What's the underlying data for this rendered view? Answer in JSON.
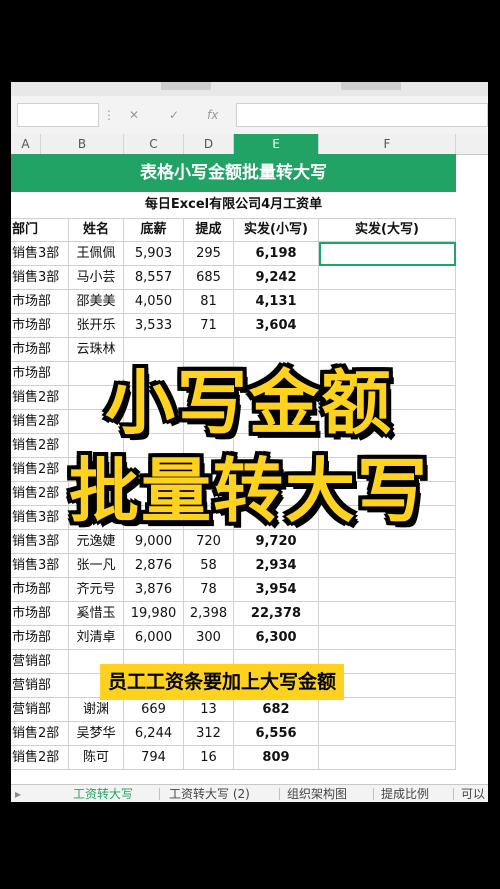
{
  "formula_bar": {
    "fx": "fx",
    "cancel": "✕",
    "confirm": "✓"
  },
  "columns": [
    "A",
    "B",
    "C",
    "D",
    "E",
    "F"
  ],
  "selected_column": "E",
  "sheet_title": "表格小写金额批量转大写",
  "sheet_subtitle": "每日Excel有限公司4月工资单",
  "table": {
    "headers": [
      "部门",
      "姓名",
      "底薪",
      "提成",
      "实发(小写)",
      "实发(大写)"
    ],
    "rows": [
      [
        "销售3部",
        "王佩佩",
        "5,903",
        "295",
        "6,198",
        ""
      ],
      [
        "销售3部",
        "马小芸",
        "8,557",
        "685",
        "9,242",
        ""
      ],
      [
        "市场部",
        "邵美美",
        "4,050",
        "81",
        "4,131",
        ""
      ],
      [
        "市场部",
        "张开乐",
        "3,533",
        "71",
        "3,604",
        ""
      ],
      [
        "市场部",
        "云珠林",
        "",
        "",
        "",
        ""
      ],
      [
        "市场部",
        "",
        "",
        "",
        "",
        ""
      ],
      [
        "销售2部",
        "",
        "",
        "",
        "",
        ""
      ],
      [
        "销售2部",
        "",
        "",
        "",
        "",
        ""
      ],
      [
        "销售2部",
        "",
        "",
        "",
        "",
        ""
      ],
      [
        "销售2部",
        "",
        "",
        "",
        "",
        ""
      ],
      [
        "销售2部",
        "",
        "",
        "",
        "",
        ""
      ],
      [
        "销售3部",
        "",
        "",
        "",
        "",
        ""
      ],
      [
        "销售3部",
        "元逸婕",
        "9,000",
        "720",
        "9,720",
        ""
      ],
      [
        "销售3部",
        "张一凡",
        "2,876",
        "58",
        "2,934",
        ""
      ],
      [
        "市场部",
        "齐元号",
        "3,876",
        "78",
        "3,954",
        ""
      ],
      [
        "市场部",
        "奚惜玉",
        "19,980",
        "2,398",
        "22,378",
        ""
      ],
      [
        "市场部",
        "刘清卓",
        "6,000",
        "300",
        "6,300",
        ""
      ],
      [
        "营销部",
        "",
        "",
        "",
        "",
        ""
      ],
      [
        "营销部",
        "",
        "",
        "",
        "",
        ""
      ],
      [
        "营销部",
        "谢渊",
        "669",
        "13",
        "682",
        ""
      ],
      [
        "销售2部",
        "吴梦华",
        "6,244",
        "312",
        "6,556",
        ""
      ],
      [
        "销售2部",
        "陈可",
        "794",
        "16",
        "809",
        ""
      ]
    ]
  },
  "overlay": {
    "line1": "小写金额",
    "line2": "批量转大写"
  },
  "caption": "员工工资条要加上大写金额",
  "sheet_tabs": [
    "工资转大写",
    "工资转大写 (2)",
    "组织架构图",
    "提成比例",
    "可以"
  ],
  "active_tab": 0,
  "colors": {
    "accent": "#21a366",
    "highlight": "#ffd21f"
  }
}
